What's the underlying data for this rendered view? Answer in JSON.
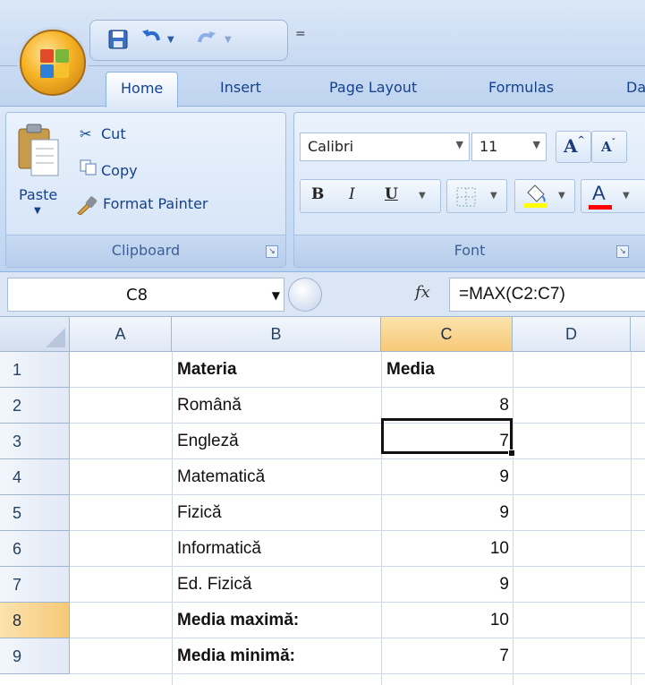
{
  "quick_access": {
    "customize_glyph": "="
  },
  "ribbon": {
    "tabs": [
      "Home",
      "Insert",
      "Page Layout",
      "Formulas",
      "Da"
    ],
    "clipboard": {
      "paste": "Paste",
      "cut": "Cut",
      "copy": "Copy",
      "format_painter": "Format Painter",
      "label": "Clipboard"
    },
    "font": {
      "name": "Calibri",
      "size": "11",
      "bold": "B",
      "italic": "I",
      "underline": "U",
      "grow": "A",
      "shrink": "A",
      "font_color_glyph": "A",
      "label": "Font"
    }
  },
  "formula_bar": {
    "name_box": "C8",
    "fx": "fx",
    "formula": "=MAX(C2:C7)"
  },
  "sheet": {
    "columns": [
      "A",
      "B",
      "C",
      "D"
    ],
    "selected_column": "C",
    "selected_row": "8",
    "rows": [
      {
        "n": "1",
        "b": "Materia",
        "c": "Media",
        "bold": true
      },
      {
        "n": "2",
        "b": "Română",
        "c": "8"
      },
      {
        "n": "3",
        "b": "Engleză",
        "c": "7"
      },
      {
        "n": "4",
        "b": "Matematică",
        "c": "9"
      },
      {
        "n": "5",
        "b": "Fizică",
        "c": "9"
      },
      {
        "n": "6",
        "b": "Informatică",
        "c": "10"
      },
      {
        "n": "7",
        "b": "Ed. Fizică",
        "c": "9"
      },
      {
        "n": "8",
        "b": "Media maximă:",
        "c": "10",
        "bold": true
      },
      {
        "n": "9",
        "b": "Media minimă:",
        "c": "7",
        "bold": true
      }
    ]
  },
  "colors": {
    "ribbon": "#c7dbf4",
    "selected_header": "#f7c978",
    "grid_line": "#d0d7e5"
  }
}
